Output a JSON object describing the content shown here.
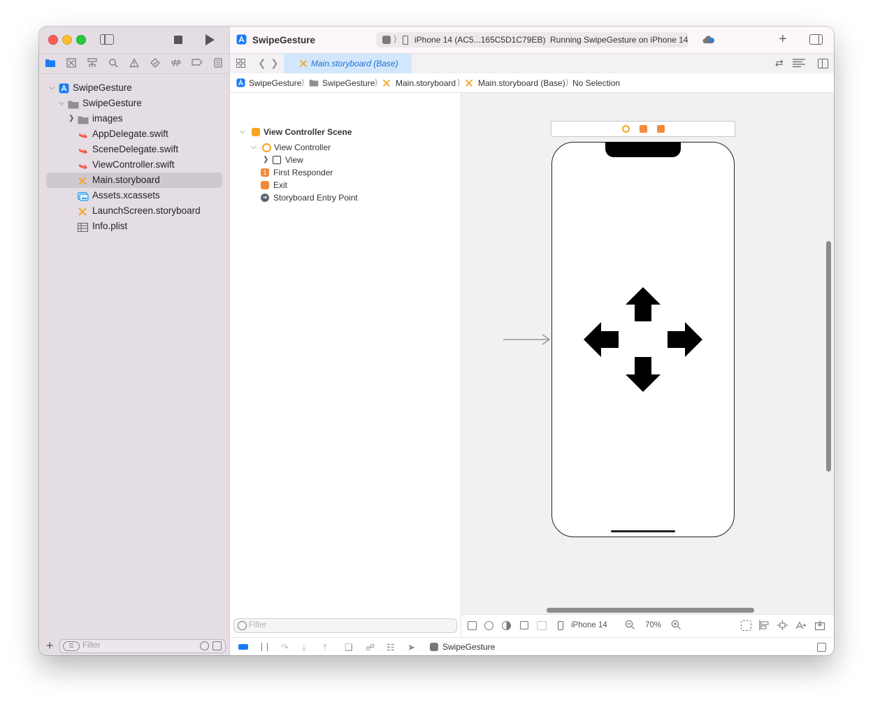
{
  "window": {
    "project_title": "SwipeGesture",
    "scheme_target": "iPhone 14 (AC5...165C5D1C79EB)",
    "run_status": "Running SwipeGesture on iPhone 14",
    "editor_tab": "Main.storyboard (Base)"
  },
  "navigator": {
    "items": [
      {
        "label": "SwipeGesture",
        "icon": "app-project-icon"
      },
      {
        "label": "SwipeGesture",
        "icon": "folder-icon"
      },
      {
        "label": "images",
        "icon": "folder-icon"
      },
      {
        "label": "AppDelegate.swift",
        "icon": "swift-file-icon"
      },
      {
        "label": "SceneDelegate.swift",
        "icon": "swift-file-icon"
      },
      {
        "label": "ViewController.swift",
        "icon": "swift-file-icon"
      },
      {
        "label": "Main.storyboard",
        "icon": "storyboard-file-icon"
      },
      {
        "label": "Assets.xcassets",
        "icon": "asset-catalog-icon"
      },
      {
        "label": "LaunchScreen.storyboard",
        "icon": "storyboard-file-icon"
      },
      {
        "label": "Info.plist",
        "icon": "plist-table-icon"
      }
    ],
    "selected_index": 6,
    "filter_placeholder": "Filter"
  },
  "jumpbar": {
    "crumbs": [
      "SwipeGesture",
      "SwipeGesture",
      "Main.storyboard",
      "Main.storyboard (Base)",
      "No Selection"
    ]
  },
  "outline": {
    "scene_title": "View Controller Scene",
    "items": [
      "View Controller",
      "View",
      "First Responder",
      "Exit",
      "Storyboard Entry Point"
    ],
    "filter_placeholder": "Filter"
  },
  "canvas": {
    "device_label": "iPhone 14",
    "zoom": "70%"
  },
  "debug": {
    "process_label": "SwipeGesture"
  },
  "colors": {
    "accent_blue": "#1a7cf3",
    "storyboard_orange": "#f5a623",
    "swift_orange": "#f05138",
    "sidebar_bg": "#e4dee4",
    "selection_bg": "#cfc8cf"
  }
}
